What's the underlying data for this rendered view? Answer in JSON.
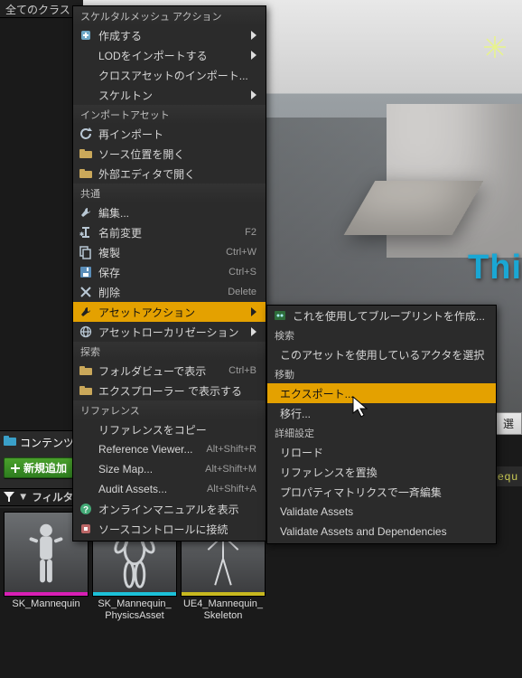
{
  "header": {
    "title": "全てのクラス"
  },
  "viewport": {
    "text3d": "Thi",
    "sparkle_color": "#e8f48a"
  },
  "left": {
    "contents_label": "コンテンツ",
    "new_label": "新規追加",
    "filter_label": "フィルタ"
  },
  "right_side": {
    "button_label": "選",
    "tab_label": "nequ"
  },
  "assets": [
    {
      "name": "SK_Mannequin",
      "strip": "magenta"
    },
    {
      "name": "SK_Mannequin_\nPhysicsAsset",
      "strip": "cyan"
    },
    {
      "name": "UE4_Mannequin_\nSkeleton",
      "strip": "yellow"
    }
  ],
  "menu1": {
    "sections": [
      {
        "title": "スケルタルメッシュ アクション",
        "items": [
          {
            "icon": "new-asset-icon",
            "label": "作成する",
            "arrow": true
          },
          {
            "icon": null,
            "label": "LODをインポートする",
            "arrow": true
          },
          {
            "icon": null,
            "label": "クロスアセットのインポート..."
          },
          {
            "icon": null,
            "label": "スケルトン",
            "arrow": true
          }
        ]
      },
      {
        "title": "インポートアセット",
        "items": [
          {
            "icon": "reimport-icon",
            "label": "再インポート"
          },
          {
            "icon": "folder-icon",
            "label": "ソース位置を開く"
          },
          {
            "icon": "folder-icon",
            "label": "外部エディタで開く"
          }
        ]
      },
      {
        "title": "共通",
        "items": [
          {
            "icon": "wrench-icon",
            "label": "編集..."
          },
          {
            "icon": "rename-icon",
            "label": "名前変更",
            "shortcut": "F2"
          },
          {
            "icon": "duplicate-icon",
            "label": "複製",
            "shortcut": "Ctrl+W"
          },
          {
            "icon": "save-icon",
            "label": "保存",
            "shortcut": "Ctrl+S"
          },
          {
            "icon": "delete-icon",
            "label": "削除",
            "shortcut": "Delete"
          },
          {
            "icon": "wrench-icon",
            "label": "アセットアクション",
            "arrow": true,
            "highlight": true
          },
          {
            "icon": "globe-icon",
            "label": "アセットローカリゼーション",
            "arrow": true
          }
        ]
      },
      {
        "title": "探索",
        "items": [
          {
            "icon": "folder-icon",
            "label": "フォルダビューで表示",
            "shortcut": "Ctrl+B"
          },
          {
            "icon": "folder-icon",
            "label": "エクスプローラー で表示する"
          }
        ]
      },
      {
        "title": "リファレンス",
        "items": [
          {
            "icon": null,
            "label": "リファレンスをコピー"
          },
          {
            "icon": null,
            "label": "Reference Viewer...",
            "shortcut": "Alt+Shift+R"
          },
          {
            "icon": null,
            "label": "Size Map...",
            "shortcut": "Alt+Shift+M"
          },
          {
            "icon": null,
            "label": "Audit Assets...",
            "shortcut": "Alt+Shift+A"
          },
          {
            "icon": "help-icon",
            "label": "オンラインマニュアルを表示"
          }
        ]
      },
      {
        "title": "",
        "items": [
          {
            "icon": "scc-icon",
            "label": "ソースコントロールに接続"
          }
        ]
      }
    ]
  },
  "menu2": {
    "top_item": {
      "icon": "blueprint-icon",
      "label": "これを使用してブループリントを作成..."
    },
    "sections": [
      {
        "title": "検索",
        "items": [
          {
            "label": "このアセットを使用しているアクタを選択"
          }
        ]
      },
      {
        "title": "移動",
        "items": [
          {
            "label": "エクスポート...",
            "highlight": true
          },
          {
            "label": "移行..."
          }
        ]
      },
      {
        "title": "詳細設定",
        "items": [
          {
            "label": "リロード"
          },
          {
            "label": "リファレンスを置換"
          },
          {
            "label": "プロパティマトリクスで一斉編集"
          },
          {
            "label": "Validate Assets"
          },
          {
            "label": "Validate Assets and Dependencies"
          }
        ]
      }
    ]
  }
}
